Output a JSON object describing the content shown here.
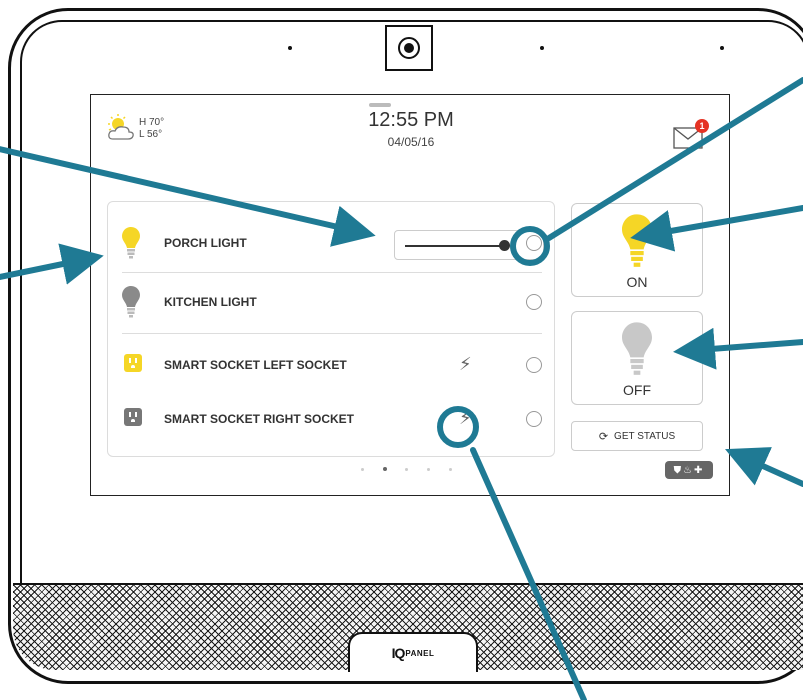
{
  "header": {
    "weather": {
      "high": "H 70°",
      "low": "L 56°",
      "icon": "partly-cloudy-icon"
    },
    "time": "12:55 PM",
    "date": "04/05/16",
    "mail": {
      "icon": "envelope-icon",
      "badge": "1"
    }
  },
  "devices": [
    {
      "name": "PORCH LIGHT",
      "icon": "bulb-icon",
      "icon_color": "#f5d626",
      "control": "dimmer-slider"
    },
    {
      "name": "KITCHEN LIGHT",
      "icon": "bulb-icon",
      "icon_color": "#8a8a8a"
    },
    {
      "name": "SMART SOCKET LEFT SOCKET",
      "icon": "socket-icon",
      "icon_color": "#f5d626",
      "power_icon": "lightning-bolt-icon"
    },
    {
      "name": "SMART SOCKET RIGHT SOCKET",
      "icon": "socket-icon",
      "icon_color": "#777777",
      "power_icon": "lightning-bolt-icon"
    }
  ],
  "controls": {
    "on_label": "ON",
    "off_label": "OFF",
    "get_status_label": "GET STATUS"
  },
  "pager": {
    "pages": 5,
    "active": 2
  },
  "device_label": {
    "iq": "IQ",
    "panel": "PANEL"
  },
  "colors": {
    "accent": "#1f7a94",
    "on": "#f5d626",
    "off": "#c8c8c8",
    "badge": "#e53324"
  }
}
